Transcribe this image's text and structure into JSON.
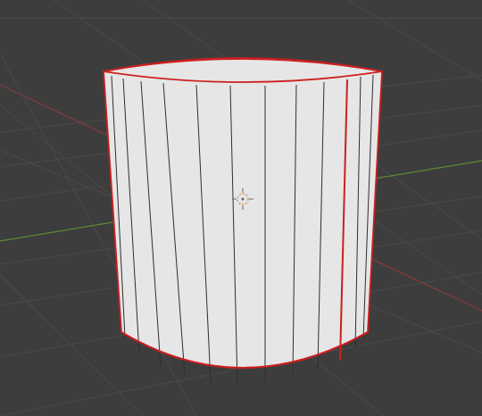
{
  "viewport": {
    "view": "3d-viewport",
    "background_color": "#3d3d3d",
    "grid_color": "#4a4a4a",
    "x_axis_color": "#8b3a3a",
    "y_axis_color": "#5c8a3a"
  },
  "object": {
    "type": "cylinder",
    "selected": true,
    "fill_color": "#e6e6e6",
    "edge_color": "#2f2f2f",
    "selected_edge_color": "#cc1f1f"
  },
  "cursor": {
    "type": "3d-cursor",
    "icon": "crosshair-cursor-icon",
    "color": "#c8864a"
  }
}
